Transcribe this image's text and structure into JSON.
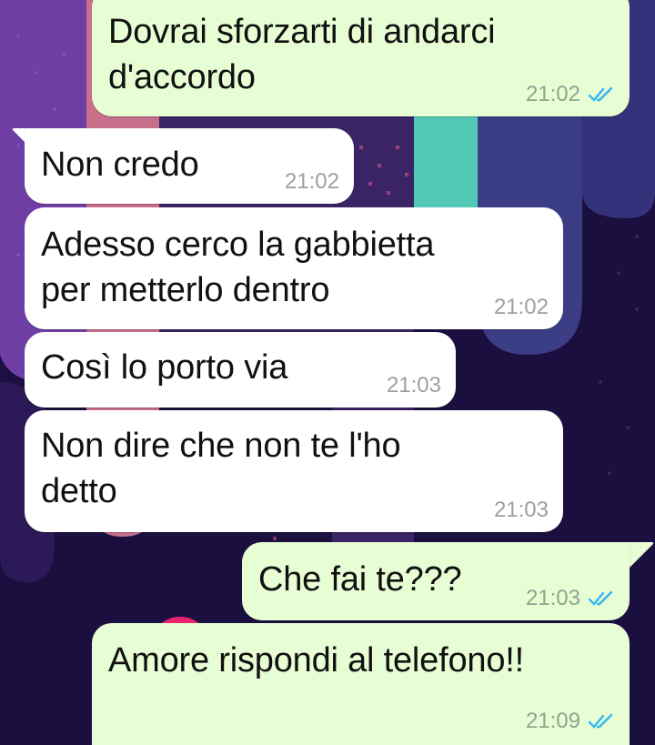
{
  "chat": {
    "messages": [
      {
        "direction": "out",
        "text": "Dovrai sforzarti di andarci\nd'accordo",
        "time": "21:02",
        "status_icon": "double-check-read-icon"
      },
      {
        "direction": "in",
        "text": "Non credo",
        "time": "21:02"
      },
      {
        "direction": "in",
        "text": "Adesso cerco la gabbietta\nper metterlo dentro",
        "time": "21:02"
      },
      {
        "direction": "in",
        "text": "Così lo porto via",
        "time": "21:03"
      },
      {
        "direction": "in",
        "text": "Non dire che non te l'ho\ndetto",
        "time": "21:03"
      },
      {
        "direction": "out",
        "text": "Che fai te???",
        "time": "21:03",
        "status_icon": "double-check-read-icon"
      },
      {
        "direction": "out",
        "text": "Amore rispondi al telefono!!",
        "time": "21:09",
        "status_icon": "double-check-read-icon"
      }
    ]
  },
  "colors": {
    "incoming_bubble": "#ffffff",
    "outgoing_bubble": "#e7fdd4",
    "read_tick": "#34b7f1",
    "timestamp": "#9aa29c"
  }
}
